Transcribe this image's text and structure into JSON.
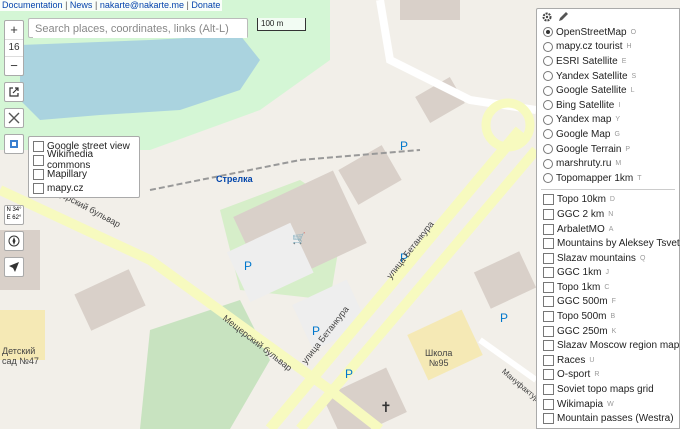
{
  "top_links": {
    "documentation": "Documentation",
    "news": "News",
    "email": "nakarte@nakarte.me",
    "donate": "Donate",
    "sep": "|"
  },
  "zoom": {
    "plus": "+",
    "level": "16",
    "minus": "−"
  },
  "search": {
    "placeholder": "Search places, coordinates, links (Alt-L)"
  },
  "scale": {
    "label": "100 m"
  },
  "coords": {
    "lat": "N 34°",
    "lon": "E 62°"
  },
  "overlays": {
    "items": [
      "Google street view",
      "Wikimedia commons",
      "Mapillary",
      "mapy.cz"
    ]
  },
  "base_layers": [
    {
      "label": "OpenStreetMap",
      "hotkey": "O",
      "selected": true
    },
    {
      "label": "mapy.cz tourist",
      "hotkey": "H",
      "selected": false
    },
    {
      "label": "ESRI Satellite",
      "hotkey": "E",
      "selected": false
    },
    {
      "label": "Yandex Satellite",
      "hotkey": "S",
      "selected": false
    },
    {
      "label": "Google Satellite",
      "hotkey": "L",
      "selected": false
    },
    {
      "label": "Bing Satellite",
      "hotkey": "I",
      "selected": false
    },
    {
      "label": "Yandex map",
      "hotkey": "Y",
      "selected": false
    },
    {
      "label": "Google Map",
      "hotkey": "G",
      "selected": false
    },
    {
      "label": "Google Terrain",
      "hotkey": "P",
      "selected": false
    },
    {
      "label": "marshruty.ru",
      "hotkey": "M",
      "selected": false
    },
    {
      "label": "Topomapper 1km",
      "hotkey": "T",
      "selected": false
    }
  ],
  "overlay_layers": [
    {
      "label": "Topo 10km",
      "hotkey": "D"
    },
    {
      "label": "GGC 2 km",
      "hotkey": "N"
    },
    {
      "label": "ArbaletMO",
      "hotkey": "A"
    },
    {
      "label": "Mountains by Aleksey Tsvetkov",
      "hotkey": ""
    },
    {
      "label": "Slazav mountains",
      "hotkey": "Q"
    },
    {
      "label": "GGC 1km",
      "hotkey": "J"
    },
    {
      "label": "Topo 1km",
      "hotkey": "C"
    },
    {
      "label": "GGC 500m",
      "hotkey": "F"
    },
    {
      "label": "Topo 500m",
      "hotkey": "B"
    },
    {
      "label": "GGC 250m",
      "hotkey": "K"
    },
    {
      "label": "Slazav Moscow region map",
      "hotkey": "Z"
    },
    {
      "label": "Races",
      "hotkey": "U"
    },
    {
      "label": "O-sport",
      "hotkey": "R"
    },
    {
      "label": "Soviet topo maps grid",
      "hotkey": ""
    },
    {
      "label": "Wikimapia",
      "hotkey": "W"
    },
    {
      "label": "Mountain passes (Westra)",
      "hotkey": ""
    }
  ],
  "map_labels": {
    "station": "Стрелка",
    "street1": "Мещерский бульвар",
    "street2": "Мещерский бульвар",
    "street3": "улица Бетанкура",
    "street4": "улица Бетанкура",
    "school": "Школа\n№95",
    "kindergarten": "Детский\nсад №47",
    "street5": "Мануфактурная"
  },
  "colors": {
    "water": "#aad3df",
    "park": "#c8facc",
    "road": "#f7fabf",
    "building": "#d9d0c9"
  }
}
